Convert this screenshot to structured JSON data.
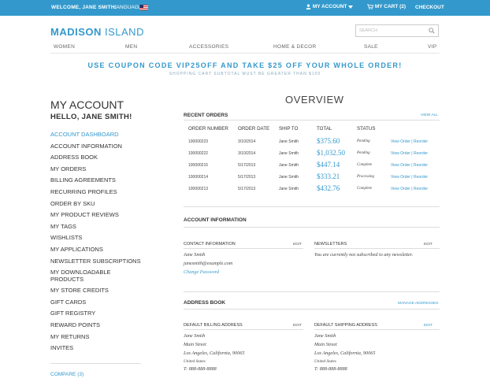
{
  "topbar": {
    "welcome": "WELCOME, JANE SMITH!",
    "language": "LANGUAGE",
    "account": "MY ACCOUNT",
    "cart": "MY CART (2)",
    "checkout": "CHECKOUT"
  },
  "header": {
    "logo_bold": "MADISON",
    "logo_rest": " ISLAND",
    "search_placeholder": "SEARCH"
  },
  "nav": [
    "WOMEN",
    "MEN",
    "ACCESSORIES",
    "HOME & DECOR",
    "SALE",
    "VIP"
  ],
  "promo": {
    "line1": "USE COUPON CODE VIP25OFF AND TAKE $25 OFF YOUR WHOLE ORDER!",
    "line2": "SHOPPING CART SUBTOTAL MUST BE GREATER THAN $100"
  },
  "sidebar": {
    "title": "MY ACCOUNT",
    "hello": "HELLO, JANE SMITH!",
    "items": [
      "ACCOUNT DASHBOARD",
      "ACCOUNT INFORMATION",
      "ADDRESS BOOK",
      "MY ORDERS",
      "BILLING AGREEMENTS",
      "RECURRING PROFILES",
      "ORDER BY SKU",
      "MY PRODUCT REVIEWS",
      "MY TAGS",
      "WISHLISTS",
      "MY APPLICATIONS",
      "NEWSLETTER SUBSCRIPTIONS",
      "MY DOWNLOADABLE PRODUCTS",
      "MY STORE CREDITS",
      "GIFT CARDS",
      "GIFT REGISTRY",
      "REWARD POINTS",
      "MY RETURNS",
      "INVITES"
    ],
    "compare": "COMPARE (3)"
  },
  "main": {
    "title": "OVERVIEW",
    "recent_orders": {
      "title": "RECENT ORDERS",
      "view_all": "VIEW ALL",
      "columns": [
        "ORDER NUMBER",
        "ORDER DATE",
        "SHIP TO",
        "TOTAL",
        "STATUS"
      ],
      "rows": [
        {
          "number": "100000223",
          "date": "3/10/2014",
          "ship_to": "Jane Smith",
          "total": "$375.60",
          "status": "Pending",
          "action": "View Order | Reorder"
        },
        {
          "number": "100000222",
          "date": "3/10/2014",
          "ship_to": "Jane Smith",
          "total": "$1,032.50",
          "status": "Pending",
          "action": "View Order | Reorder"
        },
        {
          "number": "100000215",
          "date": "5/17/2013",
          "ship_to": "Jane Smith",
          "total": "$447.14",
          "status": "Complete",
          "action": "View Order | Reorder"
        },
        {
          "number": "100000214",
          "date": "5/17/2013",
          "ship_to": "Jane Smith",
          "total": "$333.21",
          "status": "Processing",
          "action": "View Order | Reorder"
        },
        {
          "number": "100000213",
          "date": "5/17/2013",
          "ship_to": "Jane Smith",
          "total": "$432.76",
          "status": "Complete",
          "action": "View Order | Reorder"
        }
      ]
    },
    "account_info": {
      "title": "ACCOUNT INFORMATION",
      "contact_title": "CONTACT INFORMATION",
      "contact_edit": "EDIT",
      "name": "Jane Smith",
      "email": "janesmith@example.com",
      "change_password": "Change Password",
      "newsletters_title": "NEWSLETTERS",
      "newsletters_edit": "EDIT",
      "newsletters_text": "You are currently not subscribed to any newsletter."
    },
    "address_book": {
      "title": "ADDRESS BOOK",
      "manage": "MANAGE ADDRESSES",
      "billing_title": "DEFAULT BILLING ADDRESS",
      "billing_edit": "EDIT",
      "shipping_title": "DEFAULT SHIPPING ADDRESS",
      "shipping_edit": "EDIT",
      "billing_lines": [
        "Jane Smith",
        "Main Street",
        "Los Angeles, California, 90065",
        "United States",
        "T: 888-888-8888"
      ],
      "shipping_lines": [
        "Jane Smith",
        "Main Street",
        "Los Angeles, California, 90065",
        "United States",
        "T: 888-888-8888"
      ]
    }
  },
  "colors": {
    "accent": "#3399cc",
    "text": "#333333",
    "rule": "#dddddd"
  }
}
